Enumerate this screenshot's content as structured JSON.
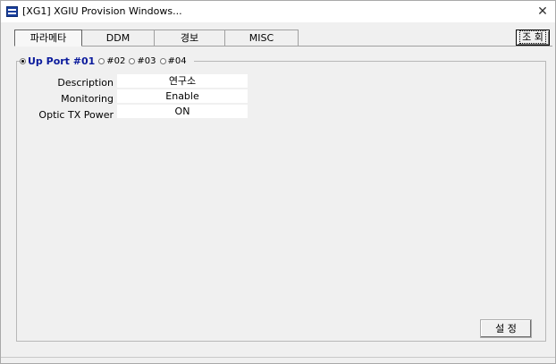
{
  "window": {
    "title": "[XG1] XGIU Provision Windows...",
    "close_glyph": "✕"
  },
  "tabs": [
    {
      "label": "파라메타",
      "active": true
    },
    {
      "label": "DDM",
      "active": false
    },
    {
      "label": "경보",
      "active": false
    },
    {
      "label": "MISC",
      "active": false
    }
  ],
  "toolbar": {
    "query_label": "조 회"
  },
  "ports": {
    "options": [
      {
        "label": "Up Port #01",
        "checked": true
      },
      {
        "label": "#02",
        "checked": false
      },
      {
        "label": "#03",
        "checked": false
      },
      {
        "label": "#04",
        "checked": false
      }
    ]
  },
  "fields": [
    {
      "label": "Description",
      "value": "연구소"
    },
    {
      "label": "Monitoring",
      "value": "Enable"
    },
    {
      "label": "Optic TX Power",
      "value": "ON"
    }
  ],
  "actions": {
    "set_label": "설 정"
  },
  "colors": {
    "selected_port": "#0a1a9c",
    "window_bg": "#f0f0f0",
    "app_icon": "#1a3f9e"
  }
}
